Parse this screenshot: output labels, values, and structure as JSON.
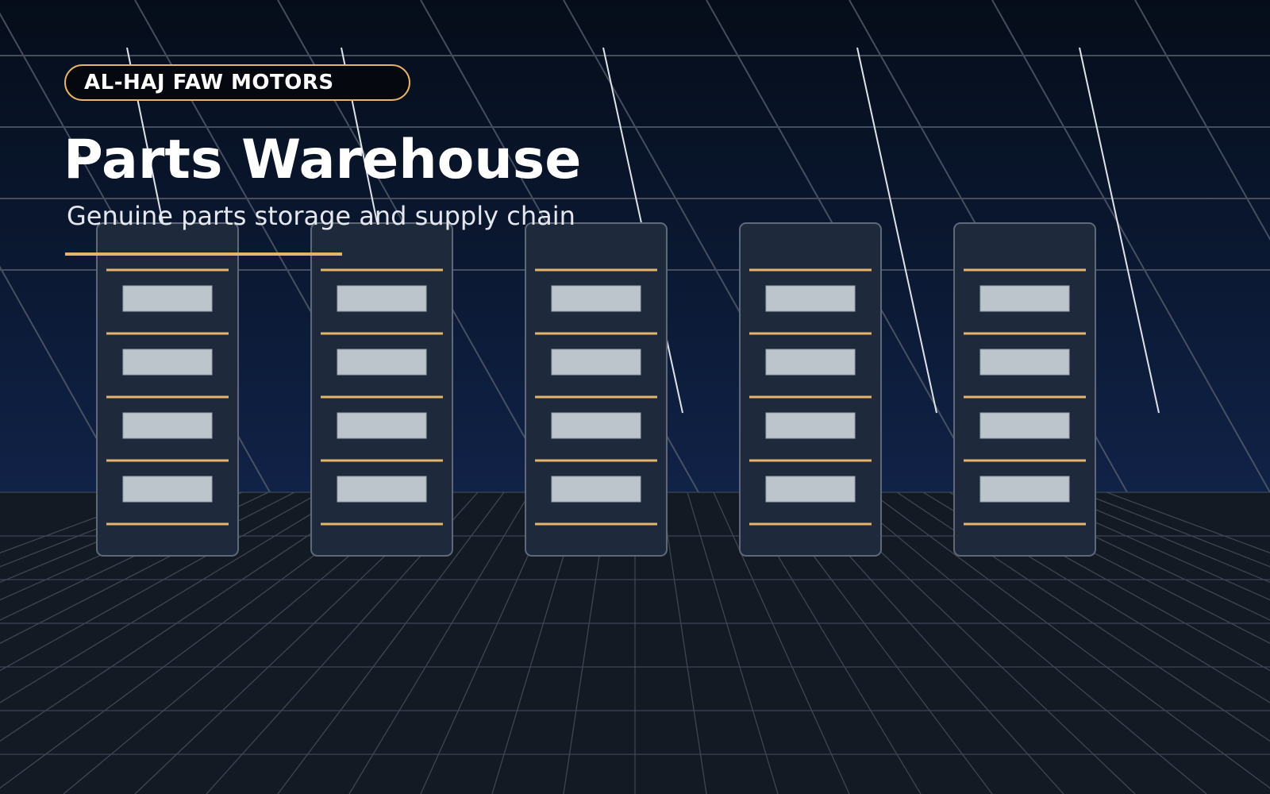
{
  "brand": {
    "name": "AL-HAJ FAW MOTORS"
  },
  "hero": {
    "title": "Parts Warehouse",
    "subtitle": "Genuine parts storage and supply chain"
  },
  "colors": {
    "accent": "#e6b36a",
    "sky_top": "#050d1a",
    "sky_bottom": "#102247",
    "floor": "#141a24",
    "rack": "#1e2a3b",
    "bin": "#bcc4cc"
  },
  "racks": [
    {
      "bins": 4
    },
    {
      "bins": 4
    },
    {
      "bins": 4
    },
    {
      "bins": 4
    },
    {
      "bins": 4
    }
  ]
}
